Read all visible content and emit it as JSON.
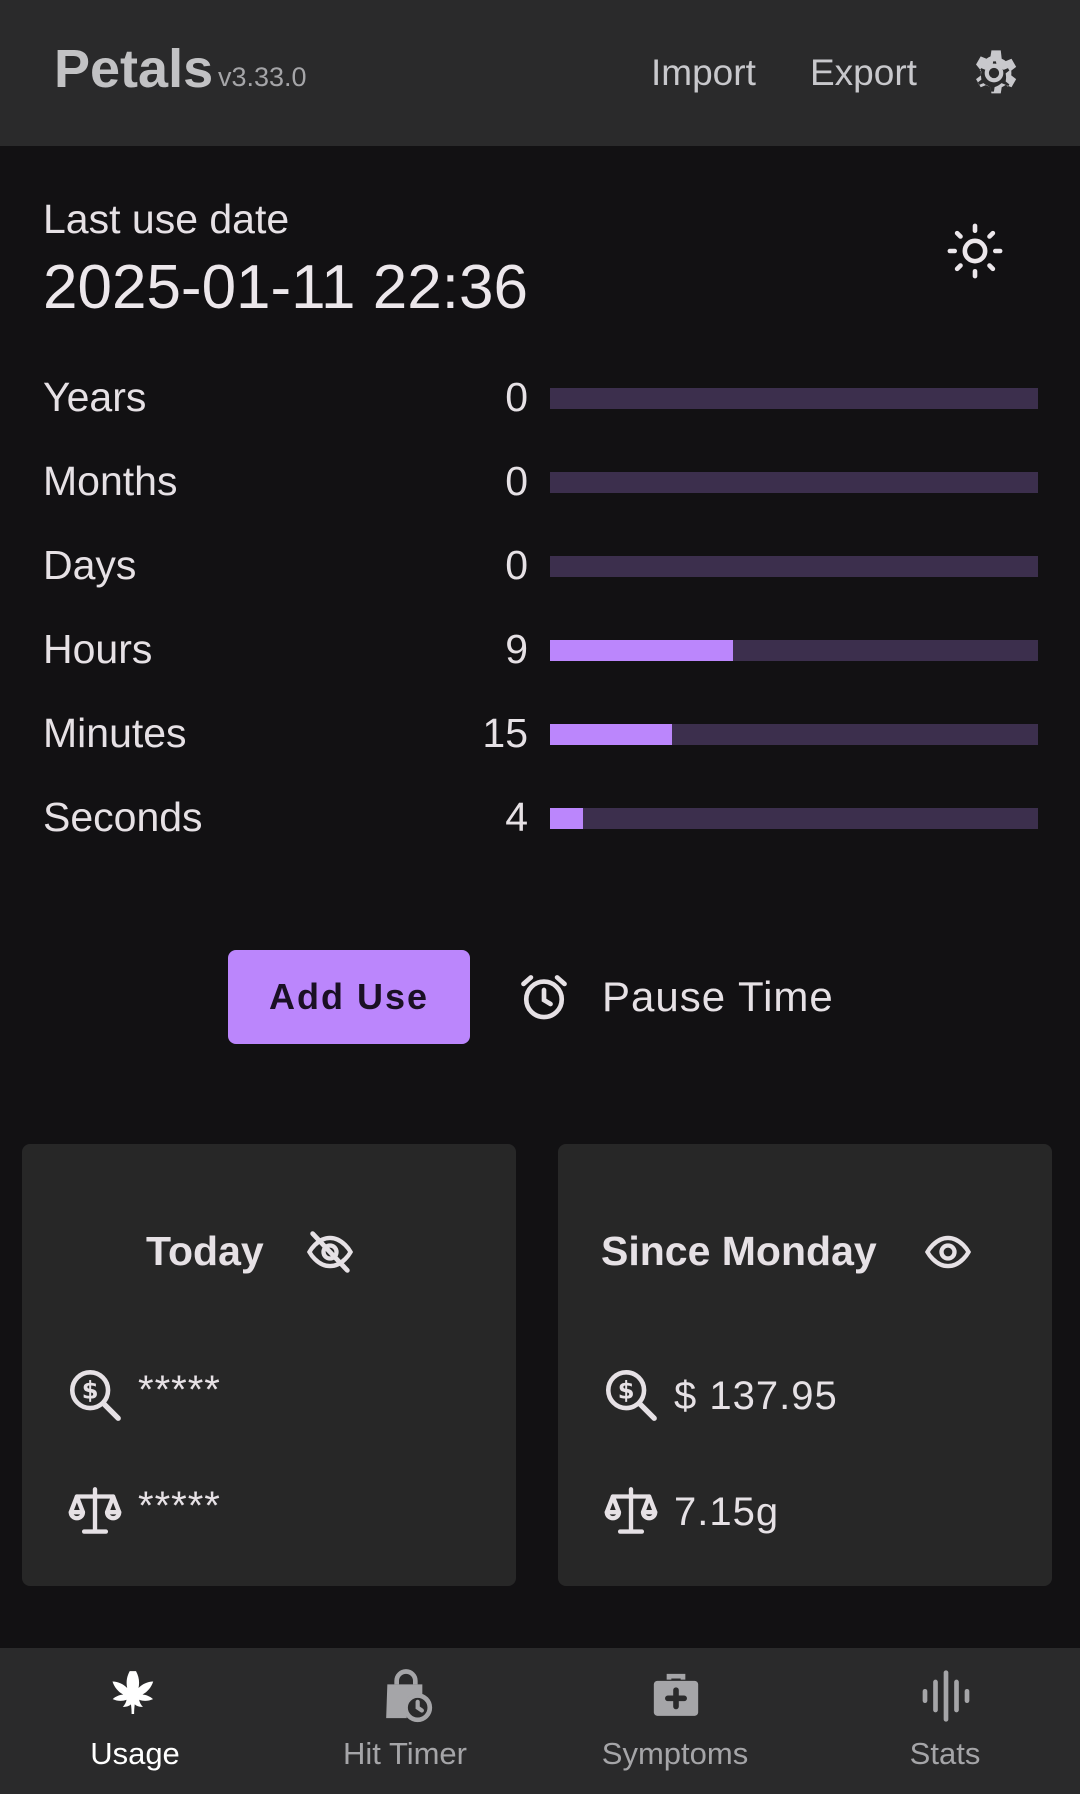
{
  "app": {
    "title": "Petals",
    "version": "v3.33.0"
  },
  "header": {
    "import_label": "Import",
    "export_label": "Export",
    "settings_icon": "gear-icon"
  },
  "last_use": {
    "label": "Last use date",
    "date": "2025-01-11 22:36",
    "theme_icon": "sun-icon"
  },
  "timer": [
    {
      "label": "Years",
      "value": "0",
      "fill": 0
    },
    {
      "label": "Months",
      "value": "0",
      "fill": 0
    },
    {
      "label": "Days",
      "value": "0",
      "fill": 0
    },
    {
      "label": "Hours",
      "value": "9",
      "fill": 0.375
    },
    {
      "label": "Minutes",
      "value": "15",
      "fill": 0.25
    },
    {
      "label": "Seconds",
      "value": "4",
      "fill": 0.0667
    }
  ],
  "actions": {
    "add_use": "Add Use",
    "pause_time": "Pause Time",
    "pause_icon": "alarm-clock-icon"
  },
  "cards": {
    "today": {
      "title": "Today",
      "cost": "*****",
      "weight": "*****",
      "visibility_icon": "eye-off-icon"
    },
    "since_monday": {
      "title": "Since Monday",
      "cost": "$ 137.95",
      "weight": "7.15g",
      "visibility_icon": "eye-icon"
    }
  },
  "nav": [
    {
      "label": "Usage",
      "icon": "cannabis-leaf-icon",
      "active": true
    },
    {
      "label": "Hit Timer",
      "icon": "bag-clock-icon",
      "active": false
    },
    {
      "label": "Symptoms",
      "icon": "medical-bag-icon",
      "active": false
    },
    {
      "label": "Stats",
      "icon": "waveform-icon",
      "active": false
    }
  ],
  "colors": {
    "accent": "#bb86fc",
    "track": "#3c2f4d",
    "background": "#121113",
    "surface": "#2a2a2b",
    "card": "#272727"
  }
}
